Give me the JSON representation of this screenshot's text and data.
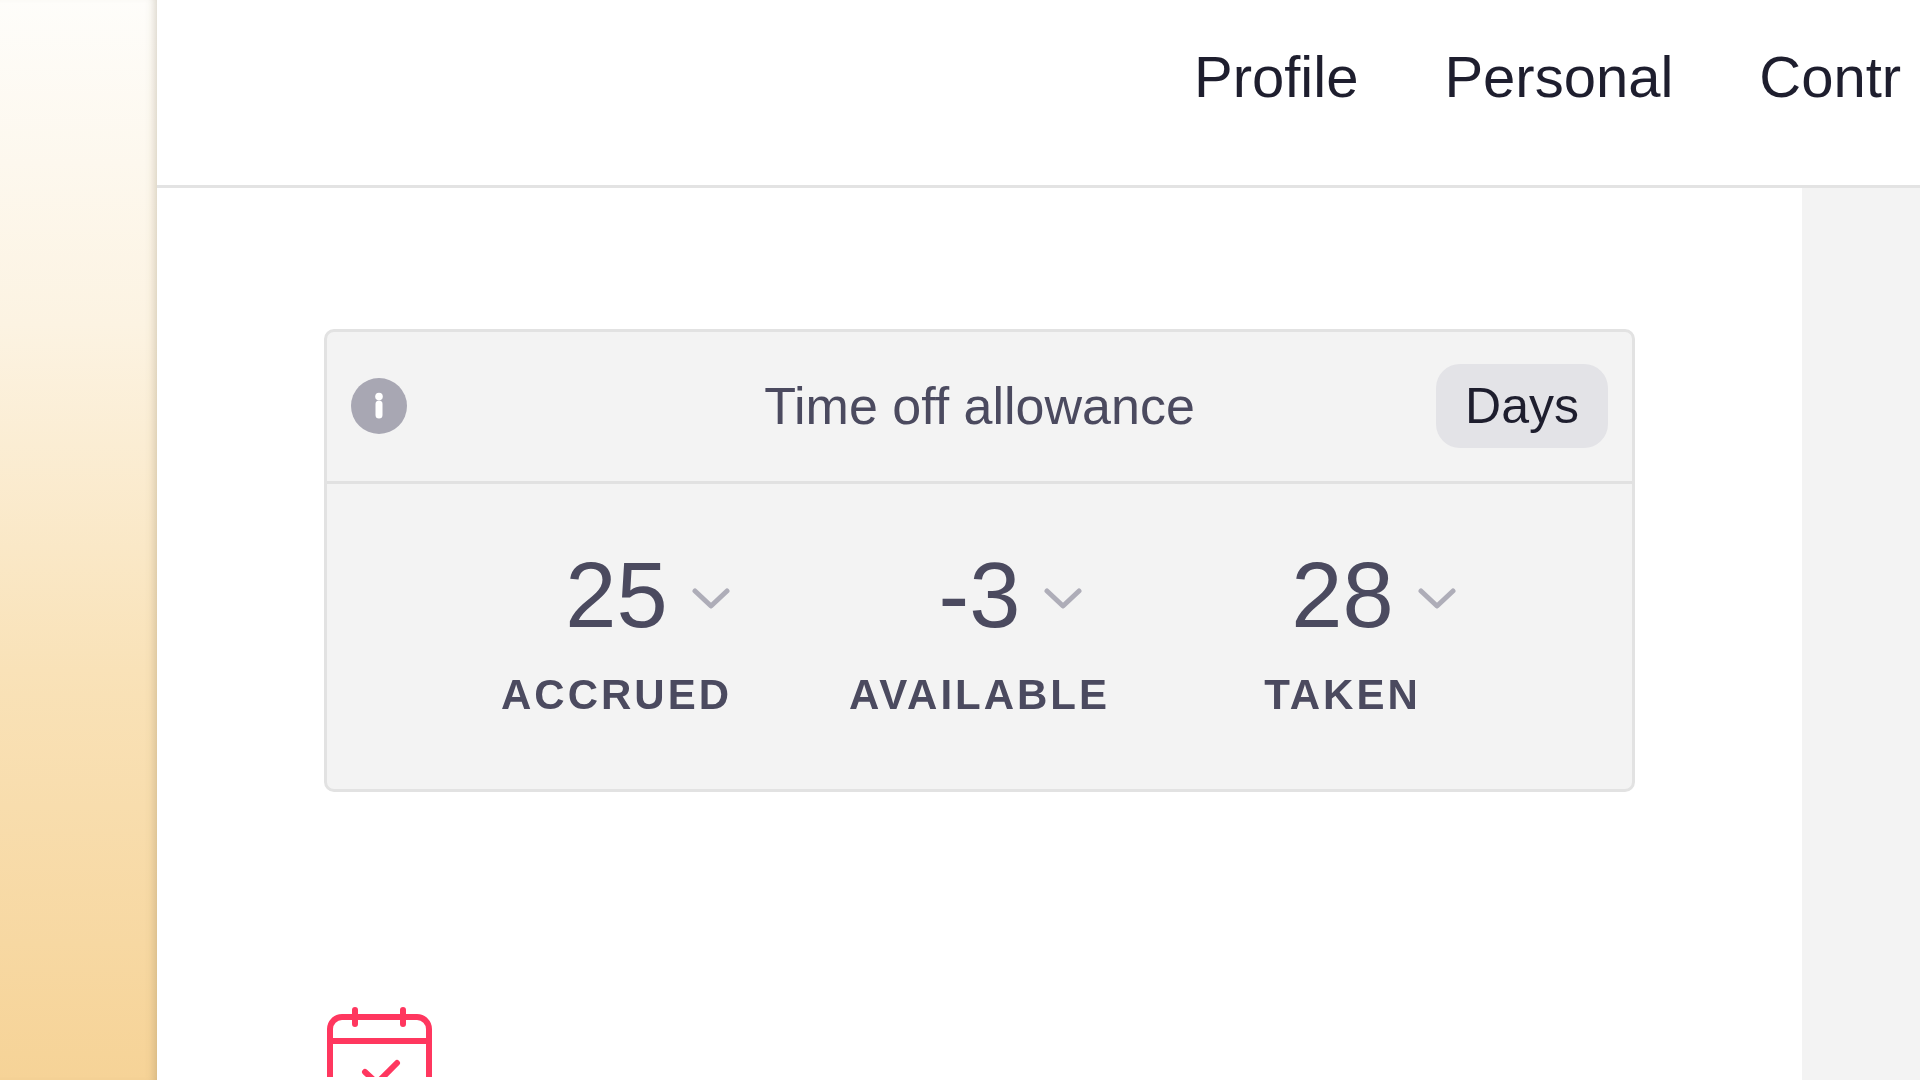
{
  "nav_tabs": [
    {
      "label": "Profile",
      "selected": false
    },
    {
      "label": "Personal",
      "selected": false
    },
    {
      "label": "Contr",
      "selected": false
    }
  ],
  "allowance_card": {
    "title": "Time off allowance",
    "unit_button": "Days",
    "stats": [
      {
        "value": "25",
        "label": "ACCRUED",
        "expanded": false
      },
      {
        "value": "-3",
        "label": "AVAILABLE",
        "expanded": false
      },
      {
        "value": "28",
        "label": "TAKEN",
        "expanded": false
      }
    ]
  }
}
